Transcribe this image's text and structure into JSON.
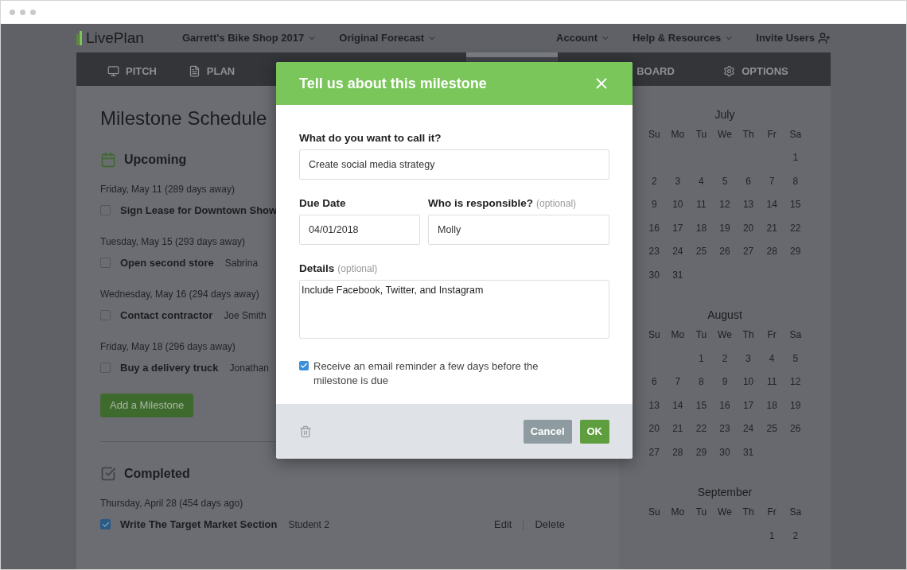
{
  "header": {
    "logo": "LivePlan",
    "plan": "Garrett's Bike Shop 2017",
    "forecast": "Original Forecast",
    "account": "Account",
    "help": "Help & Resources",
    "invite": "Invite Users"
  },
  "nav": [
    {
      "label": "PITCH",
      "selected": false
    },
    {
      "label": "PLAN",
      "selected": false
    },
    {
      "selected": true
    },
    {
      "label": "BOARD",
      "selected": false
    },
    {
      "label": "OPTIONS",
      "selected": false
    }
  ],
  "page": {
    "title": "Milestone Schedule",
    "sections": [
      {
        "kind": "upcoming",
        "title": "Upcoming",
        "milestones": [
          {
            "date": "Friday, May 11 (289 days away)",
            "name": "Sign Lease for Downtown Show",
            "checked": false
          },
          {
            "date": "Tuesday, May 15 (293 days away)",
            "name": "Open second store",
            "owner": "Sabrina",
            "checked": false
          },
          {
            "date": "Wednesday, May 16 (294 days away)",
            "name": "Contact contractor",
            "owner": "Joe Smith",
            "checked": false
          },
          {
            "date": "Friday, May 18 (296 days away)",
            "name": "Buy a delivery truck",
            "owner": "Jonathan",
            "checked": false
          }
        ],
        "add_button": "Add a Milestone"
      },
      {
        "kind": "completed",
        "title": "Completed",
        "milestones": [
          {
            "date": "Thursday, April 28 (454 days ago)",
            "name": "Write The Target Market Section",
            "owner": "Student 2",
            "checked": true,
            "actions": [
              "Edit",
              "Delete"
            ]
          }
        ]
      }
    ]
  },
  "calendar": {
    "months": [
      {
        "name": "July",
        "weekdays": [
          "Su",
          "Mo",
          "Tu",
          "We",
          "Th",
          "Fr",
          "Sa"
        ],
        "weeks": [
          [
            "1"
          ],
          [
            "2",
            "3",
            "4",
            "5",
            "6",
            "7",
            "8"
          ],
          [
            "9",
            "10",
            "11",
            "12",
            "13",
            "14",
            "15"
          ],
          [
            "16",
            "17",
            "18",
            "19",
            "20",
            "21",
            "22"
          ],
          [
            "23",
            "24",
            "25",
            "26",
            "27",
            "28",
            "29"
          ],
          [
            "30",
            "31"
          ]
        ]
      },
      {
        "name": "August",
        "weekdays": [
          "Su",
          "Mo",
          "Tu",
          "We",
          "Th",
          "Fr",
          "Sa"
        ],
        "weeks": [
          [
            "1",
            "2",
            "3",
            "4",
            "5"
          ],
          [
            "6",
            "7",
            "8",
            "9",
            "10",
            "11",
            "12"
          ],
          [
            "13",
            "14",
            "15",
            "16",
            "17",
            "18",
            "19"
          ],
          [
            "20",
            "21",
            "22",
            "23",
            "24",
            "25",
            "26"
          ],
          [
            "27",
            "28",
            "29",
            "30",
            "31"
          ]
        ]
      },
      {
        "name": "September",
        "weekdays": [
          "Su",
          "Mo",
          "Tu",
          "We",
          "Th",
          "Fr",
          "Sa"
        ],
        "weeks": [
          [
            "1",
            "2"
          ]
        ]
      }
    ]
  },
  "dialog": {
    "title": "Tell us about this milestone",
    "name_label": "What do you want to call it?",
    "name_value": "Create social media strategy",
    "due_label": "Due Date",
    "due_value": "04/01/2018",
    "owner_label": "Who is responsible?",
    "owner_hint": "(optional)",
    "owner_value": "Molly",
    "details_label": "Details",
    "details_hint": "(optional)",
    "details_value": "Include Facebook, Twitter, and Instagram",
    "reminder": {
      "label": "Receive an email reminder a few days before the milestone is due",
      "checked": true
    },
    "buttons": [
      {
        "label": "Cancel",
        "kind": "secondary"
      },
      {
        "label": "OK",
        "kind": "primary"
      }
    ]
  }
}
